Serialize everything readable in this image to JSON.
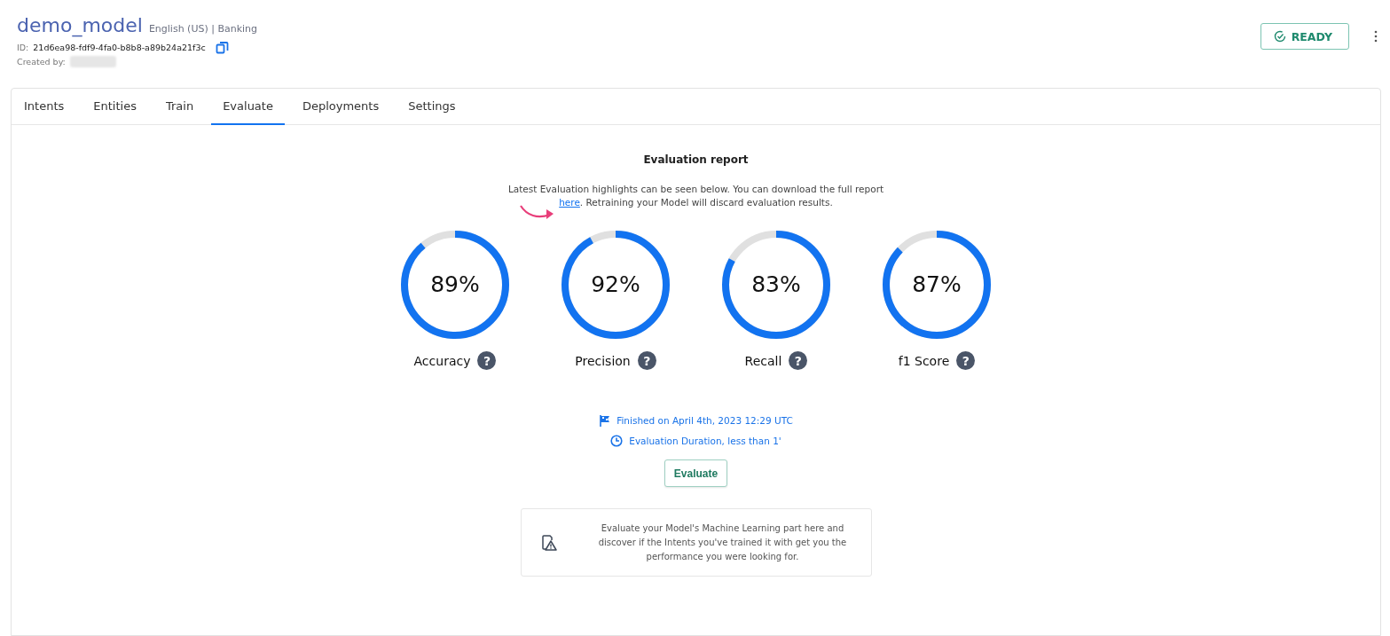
{
  "model": {
    "name": "demo_model",
    "meta": "English (US) | Banking",
    "id_label": "ID:",
    "id": "21d6ea98-fdf9-4fa0-b8b8-a89b24a21f3c",
    "created_label": "Created by:",
    "status": "READY"
  },
  "tabs": [
    {
      "label": "Intents",
      "selected": false
    },
    {
      "label": "Entities",
      "selected": false
    },
    {
      "label": "Train",
      "selected": false
    },
    {
      "label": "Evaluate",
      "selected": true
    },
    {
      "label": "Deployments",
      "selected": false
    },
    {
      "label": "Settings",
      "selected": false
    }
  ],
  "report": {
    "title": "Evaluation report",
    "intro_before": "Latest Evaluation highlights can be seen below. You can download the full report",
    "link": "here",
    "intro_after": ". Retraining your Model will discard evaluation results.",
    "metrics": [
      {
        "value": "89%",
        "label": "Accuracy",
        "help": "?",
        "level": 0.89
      },
      {
        "value": "92%",
        "label": "Precision",
        "help": "?",
        "level": 0.92
      },
      {
        "value": "83%",
        "label": "Recall",
        "help": "?",
        "level": 0.83
      },
      {
        "value": "87%",
        "label": "f1 Score",
        "help": "?",
        "level": 0.87
      }
    ],
    "finished": "Finished on April 4th, 2023 12:29 UTC",
    "duration": "Evaluation Duration, less than 1'",
    "button": "Evaluate",
    "note": "Evaluate your Model's Machine Learning part here and discover if the Intents you've trained it with get you the performance you were looking for."
  }
}
